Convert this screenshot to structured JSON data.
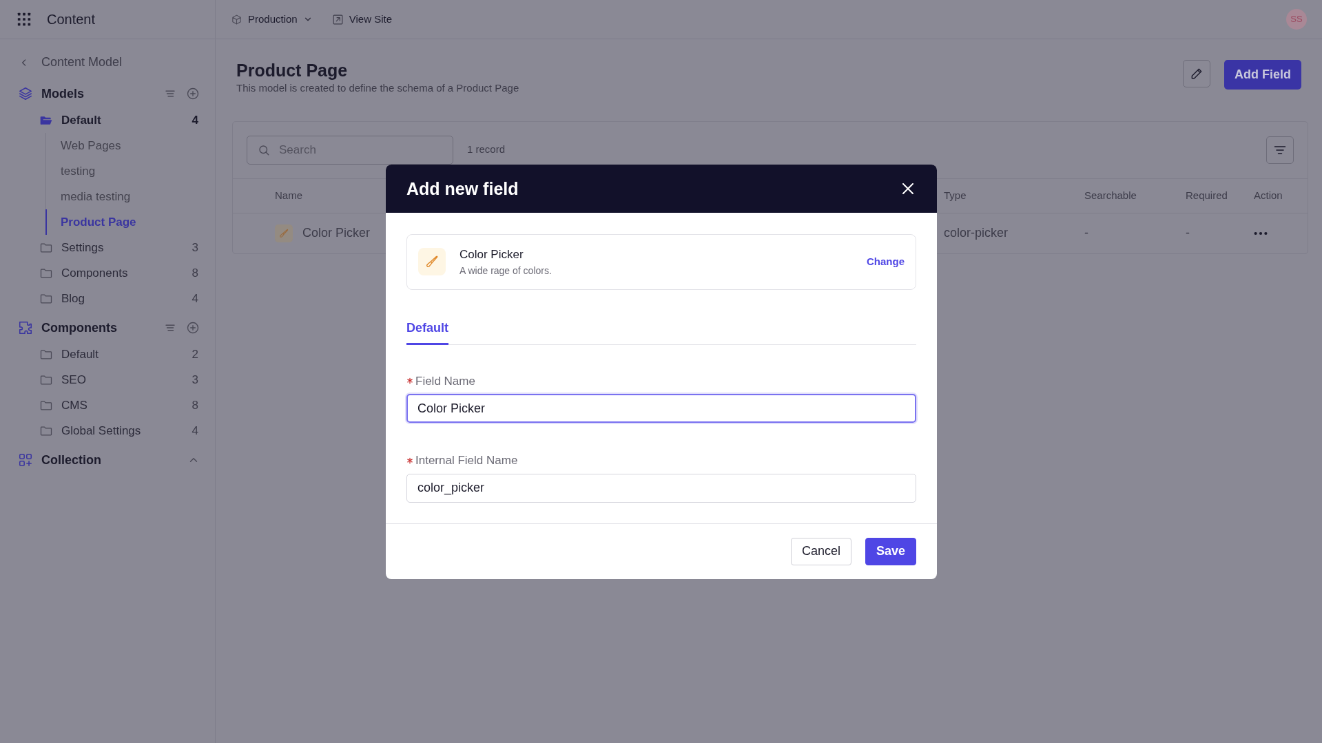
{
  "app": {
    "title": "Content"
  },
  "topbar": {
    "environment": "Production",
    "view_site": "View Site",
    "avatar": "SS"
  },
  "sidebar": {
    "back": "Content Model",
    "sections": [
      {
        "kind": "models",
        "label": "Models",
        "children": [
          {
            "label": "Default",
            "count": "4",
            "expanded": true,
            "children": [
              {
                "label": "Web Pages",
                "selected": false
              },
              {
                "label": "testing",
                "selected": false
              },
              {
                "label": "media testing",
                "selected": false
              },
              {
                "label": "Product Page",
                "selected": true
              }
            ]
          },
          {
            "label": "Settings",
            "count": "3",
            "expanded": false
          },
          {
            "label": "Components",
            "count": "8",
            "expanded": false
          },
          {
            "label": "Blog",
            "count": "4",
            "expanded": false
          }
        ]
      },
      {
        "kind": "components",
        "label": "Components",
        "children": [
          {
            "label": "Default",
            "count": "2",
            "expanded": false
          },
          {
            "label": "SEO",
            "count": "3",
            "expanded": false
          },
          {
            "label": "CMS",
            "count": "8",
            "expanded": false
          },
          {
            "label": "Global Settings",
            "count": "4",
            "expanded": false
          }
        ]
      },
      {
        "kind": "collection",
        "label": "Collection"
      }
    ]
  },
  "page": {
    "title": "Product Page",
    "subtitle": "This model is created to define the schema of a Product Page",
    "add_field": "Add Field"
  },
  "table": {
    "search": {
      "placeholder": "Search"
    },
    "record_count": "1 record",
    "columns": [
      "Name",
      "Type",
      "Searchable",
      "Required",
      "Action"
    ],
    "rows": [
      {
        "name": "Color Picker",
        "type": "color-picker",
        "searchable": "-",
        "required": "-"
      }
    ]
  },
  "modal": {
    "title": "Add new field",
    "field_type": {
      "name": "Color Picker",
      "description": "A wide rage of colors.",
      "change": "Change"
    },
    "tabs": [
      {
        "label": "Default",
        "selected": true
      }
    ],
    "fields": [
      {
        "label": "Field Name",
        "required": true,
        "value": "Color Picker",
        "focused": true
      },
      {
        "label": "Internal Field Name",
        "required": true,
        "value": "color_picker",
        "focused": false
      }
    ],
    "buttons": [
      {
        "label": "Cancel",
        "kind": "secondary"
      },
      {
        "label": "Save",
        "kind": "primary"
      }
    ]
  }
}
